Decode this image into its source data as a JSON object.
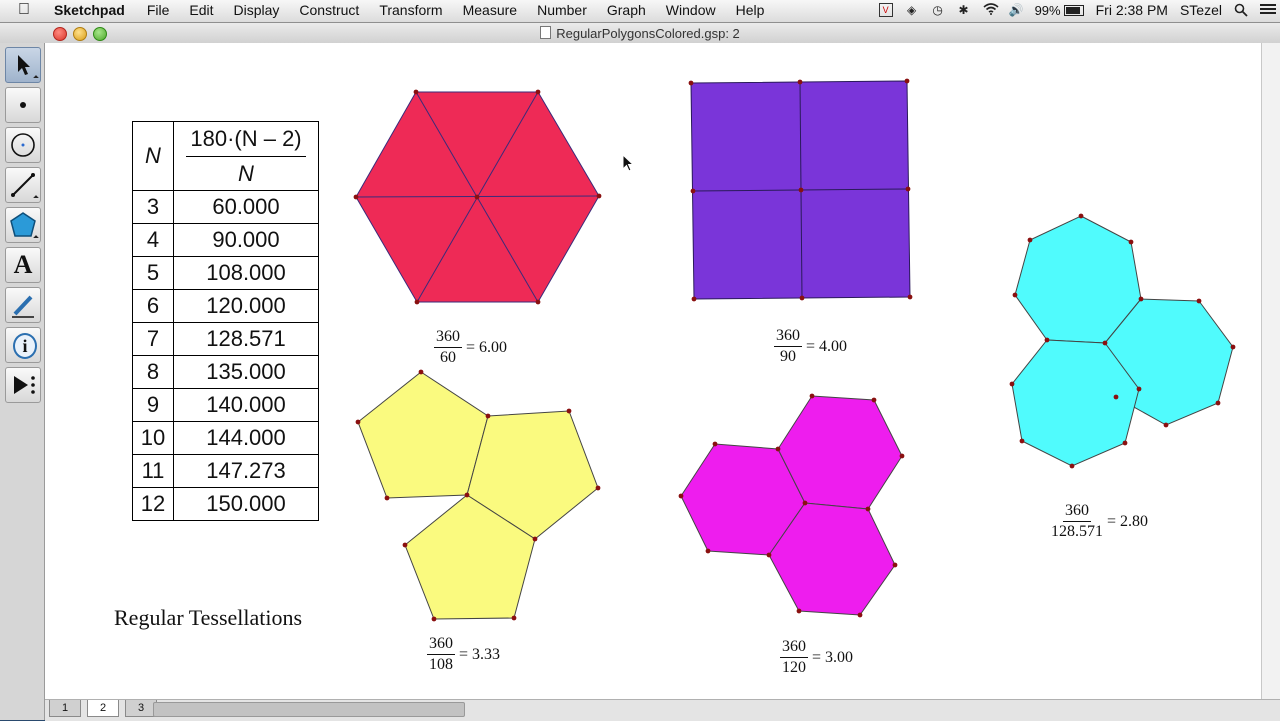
{
  "menubar": {
    "apple": "",
    "app_name": "Sketchpad",
    "menus": [
      "File",
      "Edit",
      "Display",
      "Construct",
      "Transform",
      "Measure",
      "Number",
      "Graph",
      "Window",
      "Help"
    ],
    "battery": "99%",
    "clock": "Fri 2:38 PM",
    "user": "STezel"
  },
  "window": {
    "title": "RegularPolygonsColored.gsp: 2"
  },
  "toolbox": {
    "tools": [
      "arrow-tool",
      "point-tool",
      "compass-tool",
      "straightedge-tool",
      "polygon-tool",
      "text-tool",
      "marker-tool",
      "information-tool",
      "custom-tool"
    ],
    "text_tool_glyph": "A",
    "info_tool_glyph": "i"
  },
  "table": {
    "header_n": "N",
    "header_formula_num": "180·(N – 2)",
    "header_formula_den": "N",
    "rows": [
      {
        "n": "3",
        "v": "60.000"
      },
      {
        "n": "4",
        "v": "90.000"
      },
      {
        "n": "5",
        "v": "108.000"
      },
      {
        "n": "6",
        "v": "120.000"
      },
      {
        "n": "7",
        "v": "128.571"
      },
      {
        "n": "8",
        "v": "135.000"
      },
      {
        "n": "9",
        "v": "140.000"
      },
      {
        "n": "10",
        "v": "144.000"
      },
      {
        "n": "11",
        "v": "147.273"
      },
      {
        "n": "12",
        "v": "150.000"
      }
    ]
  },
  "labels": {
    "triangles": {
      "num": "360",
      "den": "60",
      "result": "= 6.00"
    },
    "squares": {
      "num": "360",
      "den": "90",
      "result": "= 4.00"
    },
    "pentagons": {
      "num": "360",
      "den": "108",
      "result": "= 3.33"
    },
    "hexagons": {
      "num": "360",
      "den": "120",
      "result": "= 3.00"
    },
    "heptagons": {
      "num": "360",
      "den": "128.571",
      "result": "= 2.80"
    }
  },
  "caption": "Regular Tessellations",
  "colors": {
    "triangles": "#ee2a56",
    "squares": "#7a35d9",
    "pentagons": "#fafa7f",
    "hexagons": "#ee1dee",
    "heptagons": "#50fbfd",
    "vertex": "#8a1010"
  },
  "page_tabs": [
    "1",
    "2",
    "3"
  ],
  "active_tab": "2"
}
